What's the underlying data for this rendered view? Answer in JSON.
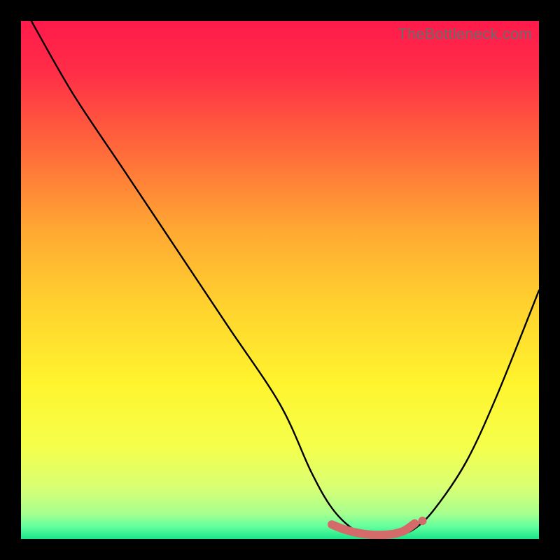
{
  "attribution": "TheBottleneck.com",
  "gradient_stops": [
    {
      "offset": 0.0,
      "color": "#ff1a4b"
    },
    {
      "offset": 0.1,
      "color": "#ff2e47"
    },
    {
      "offset": 0.25,
      "color": "#ff6a3a"
    },
    {
      "offset": 0.4,
      "color": "#ffa733"
    },
    {
      "offset": 0.55,
      "color": "#ffd22e"
    },
    {
      "offset": 0.7,
      "color": "#fff42e"
    },
    {
      "offset": 0.82,
      "color": "#f5ff4a"
    },
    {
      "offset": 0.9,
      "color": "#d9ff74"
    },
    {
      "offset": 0.95,
      "color": "#a8ff8e"
    },
    {
      "offset": 0.975,
      "color": "#66ff9d"
    },
    {
      "offset": 1.0,
      "color": "#19e58a"
    }
  ],
  "chart_data": {
    "type": "line",
    "title": "",
    "xlabel": "",
    "ylabel": "",
    "xlim": [
      0,
      100
    ],
    "ylim": [
      0,
      100
    ],
    "series": [
      {
        "name": "bottleneck-curve",
        "x": [
          2,
          10,
          20,
          30,
          40,
          50,
          56,
          60,
          64,
          68,
          72,
          76,
          80,
          86,
          92,
          100
        ],
        "y": [
          100,
          86,
          71,
          56,
          41,
          26,
          13,
          6,
          2,
          0.5,
          0.5,
          2,
          6,
          15,
          28,
          48
        ]
      }
    ],
    "markers": {
      "name": "valley-band",
      "color": "#d46a6a",
      "x": [
        60,
        62,
        64,
        66,
        68,
        70,
        72,
        74,
        76
      ],
      "y": [
        2.8,
        2.0,
        1.4,
        1.0,
        0.8,
        0.8,
        1.0,
        1.6,
        3.0
      ]
    }
  }
}
